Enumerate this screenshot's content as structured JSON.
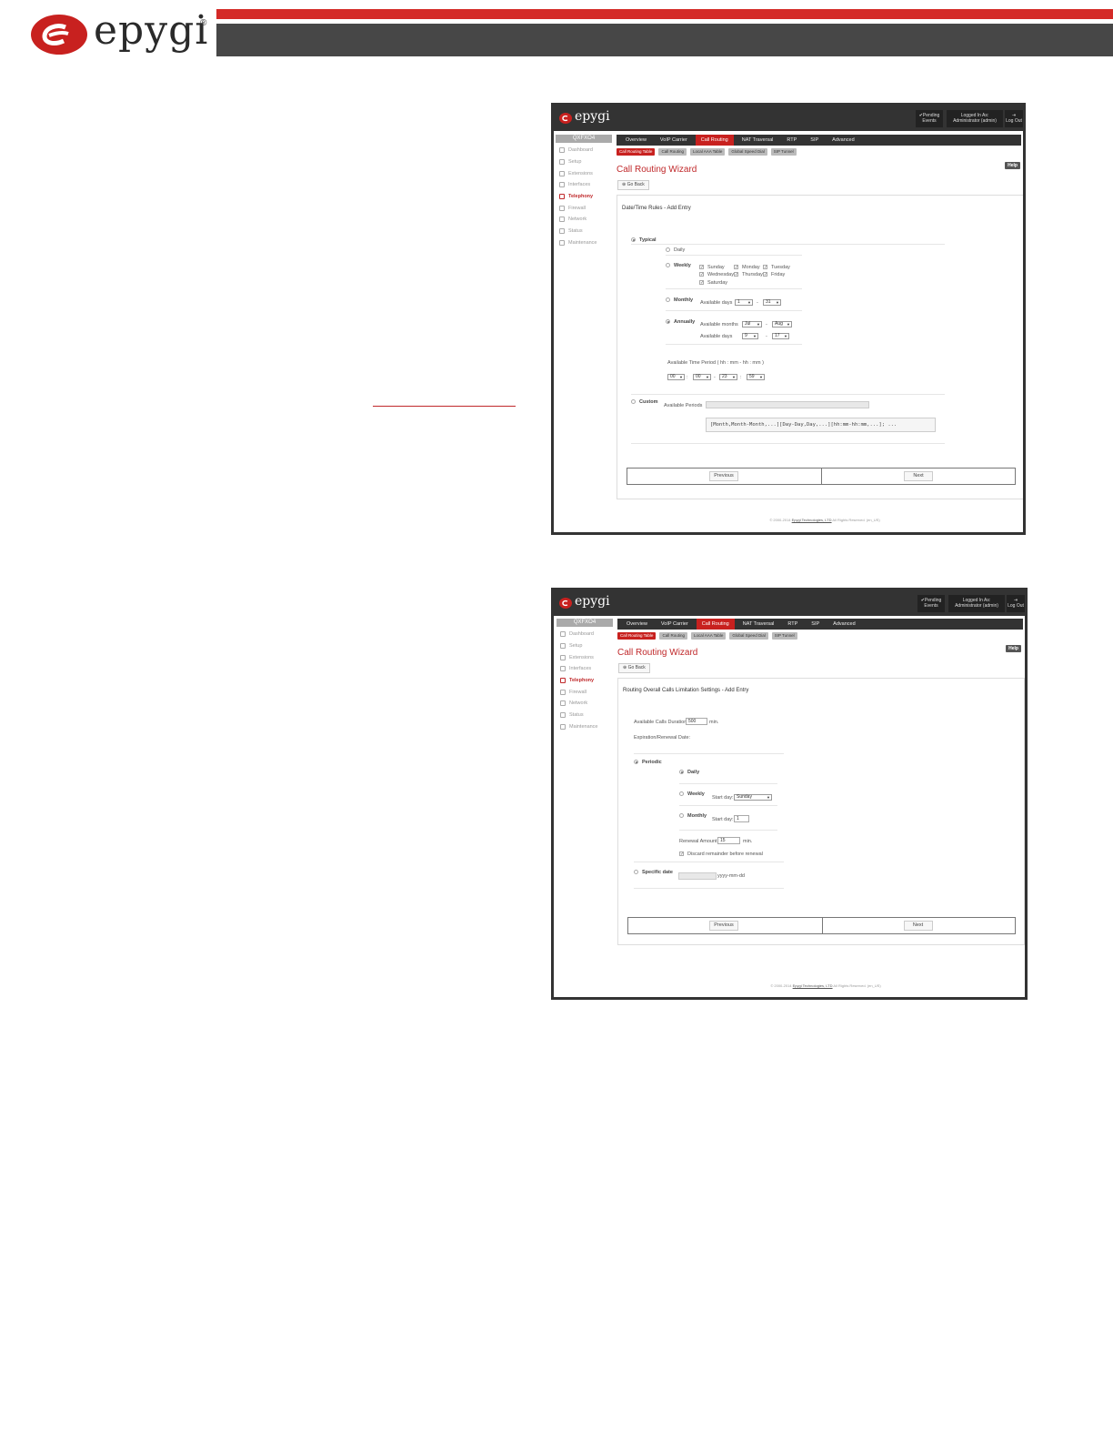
{
  "header": {
    "logo_text": "epygi",
    "reg_mark": "®",
    "brand_red": "#d42a27",
    "brand_gray": "#474747"
  },
  "screens": [
    {
      "app": {
        "logo": "epygi",
        "pending_events": "✔Pending Events",
        "logged_in_label": "Logged In As:",
        "logged_in_user": "Administrator (admin)",
        "logout_label": "Log Out"
      },
      "sidebar": {
        "title": "QXFXO4",
        "items": [
          {
            "label": "Dashboard",
            "icon": "dashboard-icon"
          },
          {
            "label": "Setup",
            "icon": "gear-icon"
          },
          {
            "label": "Extensions",
            "icon": "extensions-icon"
          },
          {
            "label": "Interfaces",
            "icon": "interfaces-icon"
          },
          {
            "label": "Telephony",
            "icon": "phone-icon"
          },
          {
            "label": "Firewall",
            "icon": "firewall-icon"
          },
          {
            "label": "Network",
            "icon": "network-icon"
          },
          {
            "label": "Status",
            "icon": "status-icon"
          },
          {
            "label": "Maintenance",
            "icon": "wrench-icon"
          }
        ]
      },
      "tabs": [
        "Overview",
        "VoIP Carrier",
        "Call Routing",
        "NAT Traversal",
        "RTP",
        "SIP",
        "Advanced"
      ],
      "subtabs": [
        "Call Routing Table",
        "Call Routing",
        "Local AAA Table",
        "Global Speed Dial",
        "SIP Tunnel"
      ],
      "title": "Call Routing Wizard",
      "help": "Help",
      "go_back": "Go Back",
      "panel_title": "Date/Time Rules - Add Entry",
      "typical": "Typical",
      "daily": "Daily",
      "weekly": "Weekly",
      "days": [
        "Sunday",
        "Monday",
        "Tuesday",
        "Wednesday",
        "Thursday",
        "Friday",
        "Saturday"
      ],
      "monthly": "Monthly",
      "available_days": "Available days",
      "monthly_from": "1",
      "monthly_to": "31",
      "annually": "Annually",
      "available_months": "Available months",
      "months_from": "Jul",
      "months_to": "Aug",
      "annual_days_from": "9",
      "annual_days_to": "17",
      "time_period_label": "Available Time Period ( hh : mm - hh : mm )",
      "time_from_h": "00",
      "time_from_m": "00",
      "time_to_h": "23",
      "time_to_m": "59",
      "dash": "-",
      "colon": ":",
      "custom": "Custom",
      "available_periods": "Available Periods",
      "format_hint": "[Month,Month-Month,...][Day-Day,Day,...][hh:mm-hh:mm,...]; ...",
      "previous": "Previous",
      "next": "Next",
      "footer_pre": "© 2000-2014",
      "footer_link": "Epygi Technologies, LTD",
      "footer_post": "All Rights Reserved. (en_US)"
    },
    {
      "app": {
        "logo": "epygi",
        "pending_events": "✔Pending Events",
        "logged_in_label": "Logged In As:",
        "logged_in_user": "Administrator (admin)",
        "logout_label": "Log Out"
      },
      "sidebar": {
        "title": "QXFXO4",
        "items": [
          {
            "label": "Dashboard",
            "icon": "dashboard-icon"
          },
          {
            "label": "Setup",
            "icon": "gear-icon"
          },
          {
            "label": "Extensions",
            "icon": "extensions-icon"
          },
          {
            "label": "Interfaces",
            "icon": "interfaces-icon"
          },
          {
            "label": "Telephony",
            "icon": "phone-icon"
          },
          {
            "label": "Firewall",
            "icon": "firewall-icon"
          },
          {
            "label": "Network",
            "icon": "network-icon"
          },
          {
            "label": "Status",
            "icon": "status-icon"
          },
          {
            "label": "Maintenance",
            "icon": "wrench-icon"
          }
        ]
      },
      "tabs": [
        "Overview",
        "VoIP Carrier",
        "Call Routing",
        "NAT Traversal",
        "RTP",
        "SIP",
        "Advanced"
      ],
      "subtabs": [
        "Call Routing Table",
        "Call Routing",
        "Local AAA Table",
        "Global Speed Dial",
        "SIP Tunnel"
      ],
      "title": "Call Routing Wizard",
      "help": "Help",
      "go_back": "Go Back",
      "panel_title": "Routing Overall Calls Limitation Settings - Add Entry",
      "available_duration": "Available Calls Duration:",
      "duration_value": "500",
      "min": "min.",
      "expiration_label": "Expiration/Renewal Date:",
      "periodic": "Periodic",
      "daily": "Daily",
      "weekly": "Weekly",
      "start_day": "Start day:",
      "weekly_value": "Sunday",
      "monthly": "Monthly",
      "monthly_value": "1",
      "renewal_amount": "Renewal Amount:",
      "renewal_value": "15",
      "discard": "Discard remainder before renewal",
      "specific_date": "Specific date",
      "date_format": "yyyy-mm-dd",
      "previous": "Previous",
      "next": "Next",
      "footer_pre": "© 2000-2014",
      "footer_link": "Epygi Technologies, LTD",
      "footer_post": "All Rights Reserved. (en_US)"
    }
  ]
}
